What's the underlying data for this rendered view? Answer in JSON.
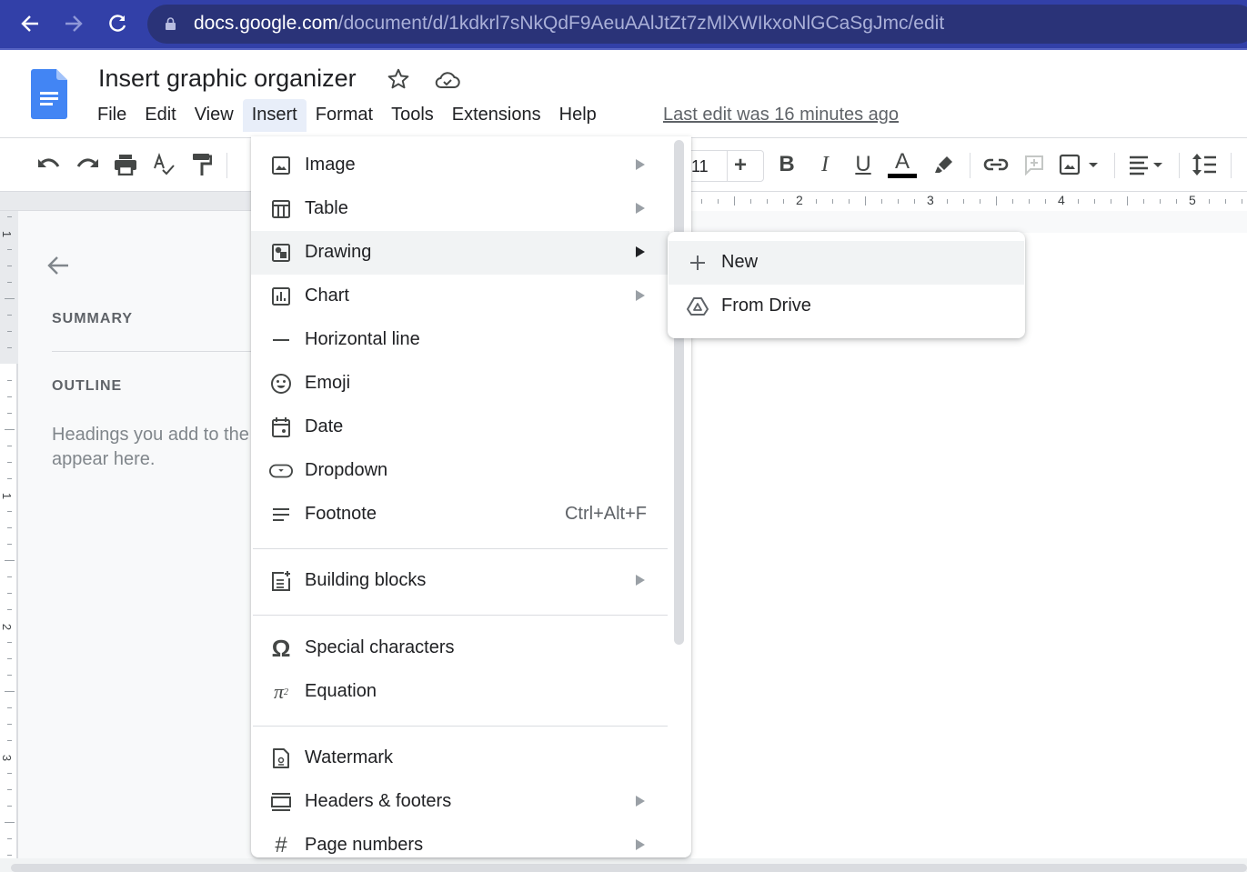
{
  "browser": {
    "back_icon": "arrow-left-icon",
    "forward_icon": "arrow-right-icon",
    "reload_icon": "reload-icon",
    "lock_icon": "lock-icon",
    "url_host": "docs.google.com",
    "url_path": "/document/d/1kdkrl7sNkQdF9AeuAAlJtZt7zMlXWIkxoNlGCaSgJmc/edit",
    "colors": {
      "chrome": "#3240a8",
      "omnibox": "#2a3378"
    }
  },
  "header": {
    "title": "Insert graphic organizer",
    "menu": [
      "File",
      "Edit",
      "View",
      "Insert",
      "Format",
      "Tools",
      "Extensions",
      "Help"
    ],
    "active_menu": "Insert",
    "last_edit": "Last edit was 16 minutes ago",
    "brand_color": "#4285f4"
  },
  "toolbar": {
    "font_size": "11",
    "font_size_plus": "+",
    "icons": [
      "undo-icon",
      "redo-icon",
      "print-icon",
      "spellcheck-icon",
      "paint-format-icon",
      "bold-icon",
      "italic-icon",
      "underline-icon",
      "text-color-icon",
      "highlight-icon",
      "link-icon",
      "add-comment-icon",
      "insert-image-icon",
      "align-icon",
      "line-spacing-icon"
    ],
    "bold": "B",
    "italic": "I",
    "underline": "U",
    "text_color_letter": "A",
    "text_color_value": "#000000"
  },
  "ruler": {
    "horizontal_numbers": [
      "2",
      "3",
      "4",
      "5"
    ],
    "vertical_numbers": [
      "1",
      "1",
      "2",
      "3"
    ]
  },
  "outline": {
    "summary_heading": "SUMMARY",
    "outline_heading": "OUTLINE",
    "hint_line1": "Headings you add to the",
    "hint_line2": "appear here."
  },
  "insert_menu": {
    "items": [
      {
        "label": "Image",
        "icon": "image-icon",
        "submenu": true
      },
      {
        "label": "Table",
        "icon": "table-icon",
        "submenu": true
      },
      {
        "label": "Drawing",
        "icon": "drawing-icon",
        "submenu": true,
        "hover": true
      },
      {
        "label": "Chart",
        "icon": "chart-icon",
        "submenu": true
      },
      {
        "label": "Horizontal line",
        "icon": "horizontal-line-icon"
      },
      {
        "label": "Emoji",
        "icon": "emoji-icon"
      },
      {
        "label": "Date",
        "icon": "calendar-icon"
      },
      {
        "label": "Dropdown",
        "icon": "dropdown-icon"
      },
      {
        "label": "Footnote",
        "icon": "footnote-icon",
        "shortcut": "Ctrl+Alt+F"
      },
      {
        "label": "Building blocks",
        "icon": "building-blocks-icon",
        "submenu": true
      },
      {
        "label": "Special characters",
        "icon": "omega-icon"
      },
      {
        "label": "Equation",
        "icon": "pi-squared-icon"
      },
      {
        "label": "Watermark",
        "icon": "watermark-icon"
      },
      {
        "label": "Headers & footers",
        "icon": "headers-footers-icon",
        "submenu": true
      },
      {
        "label": "Page numbers",
        "icon": "hash-icon",
        "submenu": true
      }
    ]
  },
  "drawing_submenu": {
    "items": [
      {
        "label": "New",
        "icon": "plus-icon",
        "hover": true
      },
      {
        "label": "From Drive",
        "icon": "drive-icon"
      }
    ]
  }
}
